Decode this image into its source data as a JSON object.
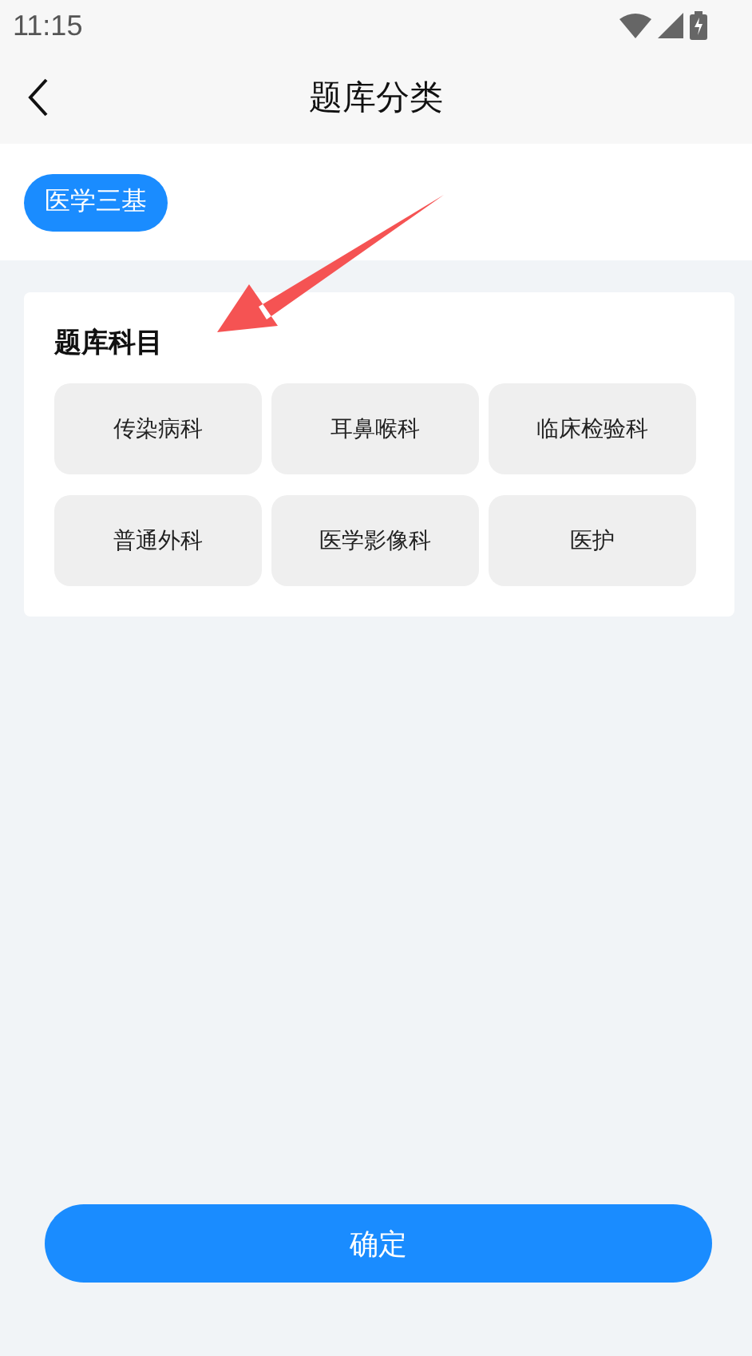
{
  "status_bar": {
    "time": "11:15"
  },
  "header": {
    "title": "题库分类"
  },
  "categories": [
    {
      "label": "医学三基",
      "selected": true
    }
  ],
  "subjects": {
    "title": "题库科目",
    "items": [
      {
        "label": "传染病科"
      },
      {
        "label": "耳鼻喉科"
      },
      {
        "label": "临床检验科"
      },
      {
        "label": "普通外科"
      },
      {
        "label": "医学影像科"
      },
      {
        "label": "医护"
      }
    ]
  },
  "confirm_button": {
    "label": "确定"
  }
}
